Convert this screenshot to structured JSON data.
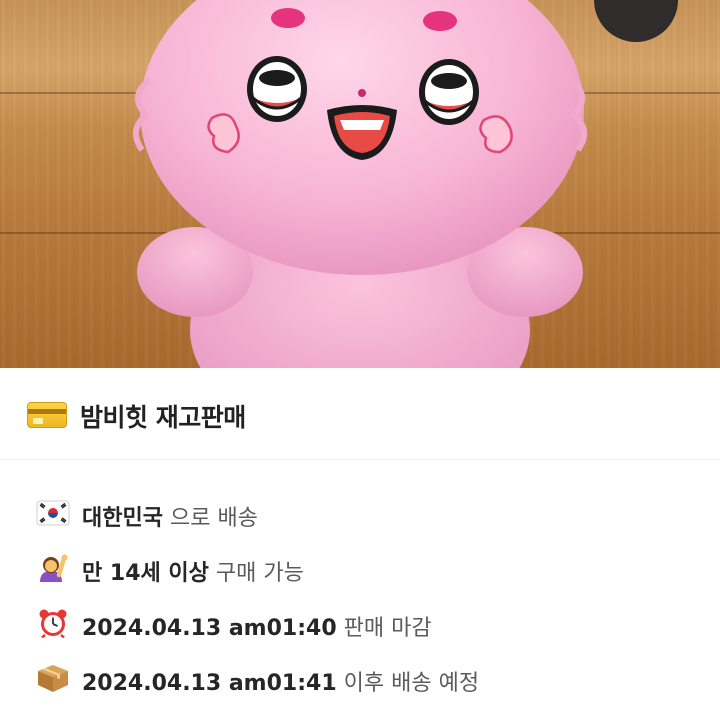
{
  "listing": {
    "photo_alt": "pink plush doll",
    "title_icon": "credit-card-icon",
    "title": "밤비힛 재고판매"
  },
  "info": [
    {
      "icon": "korea-flag-icon",
      "strong": "대한민국",
      "weak": "으로 배송"
    },
    {
      "icon": "raising-hand-icon",
      "strong": "만 14세 이상",
      "weak": "구매 가능"
    },
    {
      "icon": "alarm-clock-icon",
      "strong": "2024.04.13 am01:40",
      "weak": "판매 마감"
    },
    {
      "icon": "package-icon",
      "strong": "2024.04.13 am01:41",
      "weak": "이후 배송 예정"
    }
  ]
}
